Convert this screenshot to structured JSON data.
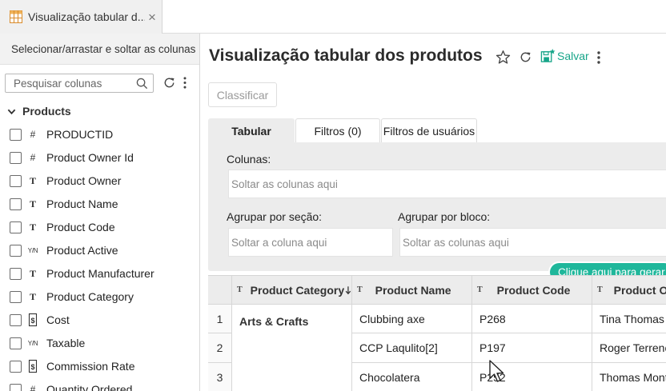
{
  "tab": {
    "title": "Visualização tabular d...",
    "icon": "table-view-icon",
    "close_icon": "close-icon"
  },
  "left_panel": {
    "header": "Selecionar/arrastar e soltar as colunas",
    "search_placeholder": "Pesquisar colunas",
    "tree_root": "Products",
    "columns": [
      {
        "type_icon": "#",
        "name": "PRODUCTID"
      },
      {
        "type_icon": "#",
        "name": "Product Owner Id"
      },
      {
        "type_icon": "T",
        "name": "Product Owner"
      },
      {
        "type_icon": "T",
        "name": "Product Name"
      },
      {
        "type_icon": "T",
        "name": "Product Code"
      },
      {
        "type_icon": "Y/N",
        "name": "Product Active"
      },
      {
        "type_icon": "T",
        "name": "Product Manufacturer"
      },
      {
        "type_icon": "T",
        "name": "Product Category"
      },
      {
        "type_icon": "currency",
        "name": "Cost"
      },
      {
        "type_icon": "Y/N",
        "name": "Taxable"
      },
      {
        "type_icon": "currency",
        "name": "Commission Rate"
      },
      {
        "type_icon": "#",
        "name": "Quantity Ordered"
      }
    ]
  },
  "main": {
    "title": "Visualização tabular dos produtos",
    "save_label": "Salvar",
    "sort_label": "Classificar",
    "tabs": [
      "Tabular",
      "Filtros  (0)",
      "Filtros de usuários"
    ],
    "active_tab": "Tabular",
    "columns_label": "Colunas:",
    "columns_drop": "Soltar as colunas aqui",
    "group_section_label": "Agrupar por seção:",
    "group_section_drop": "Soltar a coluna aqui",
    "group_block_label": "Agrupar por bloco:",
    "group_block_drop": "Soltar as colunas aqui",
    "hint": "Clique aqui para gerar"
  },
  "grid": {
    "headers": [
      "Product Category",
      "Product Name",
      "Product Code",
      "Product O"
    ],
    "header_type_marks": [
      "T",
      "T",
      "T",
      "T"
    ],
    "category": "Arts & Crafts",
    "rows": [
      {
        "index": "1",
        "name": "Clubbing axe",
        "code": "P268",
        "owner": "Tina Thomas"
      },
      {
        "index": "2",
        "name": "CCP Laqulito[2]",
        "code": "P197",
        "owner": "Roger Terrence"
      },
      {
        "index": "3",
        "name": "Chocolatera",
        "code": "P252",
        "owner": "Thomas Mont"
      }
    ]
  },
  "colors": {
    "accent": "#1fb79b",
    "save": "#17a589",
    "panel_bg": "#ececec"
  }
}
